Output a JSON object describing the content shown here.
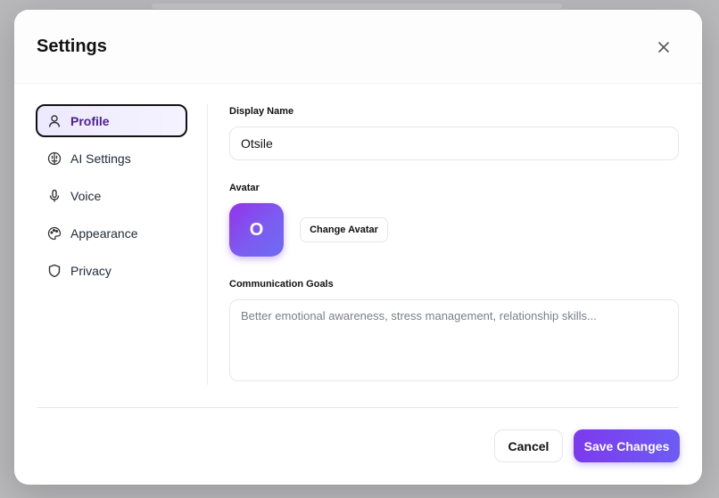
{
  "dialog": {
    "title": "Settings",
    "close_icon": "close-icon"
  },
  "nav": {
    "items": [
      {
        "label": "Profile",
        "icon": "user-icon",
        "active": true
      },
      {
        "label": "AI Settings",
        "icon": "brain-icon",
        "active": false
      },
      {
        "label": "Voice",
        "icon": "microphone-icon",
        "active": false
      },
      {
        "label": "Appearance",
        "icon": "palette-icon",
        "active": false
      },
      {
        "label": "Privacy",
        "icon": "shield-icon",
        "active": false
      }
    ]
  },
  "profile": {
    "display_name_label": "Display Name",
    "display_name_value": "Otsile",
    "avatar_label": "Avatar",
    "avatar_initial": "O",
    "change_avatar_label": "Change Avatar",
    "goals_label": "Communication Goals",
    "goals_value": "",
    "goals_placeholder": "Better emotional awareness, stress management, relationship skills..."
  },
  "footer": {
    "cancel_label": "Cancel",
    "save_label": "Save Changes"
  },
  "colors": {
    "accent": "#7c3aed",
    "accent_secondary": "#6d5cf5",
    "active_nav_bg": "#ede9fe"
  }
}
